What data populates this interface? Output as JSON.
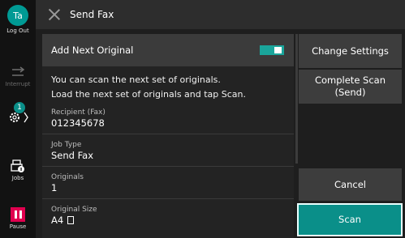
{
  "sidebar": {
    "avatar_initials": "Ta",
    "logout_label": "Log Out",
    "interrupt_label": "Interrupt",
    "settings_badge": "1",
    "jobs_label": "Jobs",
    "pause_label": "Pause"
  },
  "header": {
    "title": "Send Fax"
  },
  "panel": {
    "toggle_label": "Add Next Original",
    "toggle_on": true,
    "message_line1": "You can scan the next set of originals.",
    "message_line2": "Load the next set of originals and tap Scan.",
    "fields": [
      {
        "label": "Recipient (Fax)",
        "value": "012345678"
      },
      {
        "label": "Job Type",
        "value": "Send Fax"
      },
      {
        "label": "Originals",
        "value": "1"
      },
      {
        "label": "Original Size",
        "value": "A4"
      }
    ]
  },
  "buttons": {
    "change_settings": "Change Settings",
    "complete_scan_line1": "Complete Scan",
    "complete_scan_line2": "(Send)",
    "cancel": "Cancel",
    "scan": "Scan"
  },
  "colors": {
    "accent": "#0a8f89",
    "avatar": "#009a94",
    "pause": "#e0004f"
  }
}
